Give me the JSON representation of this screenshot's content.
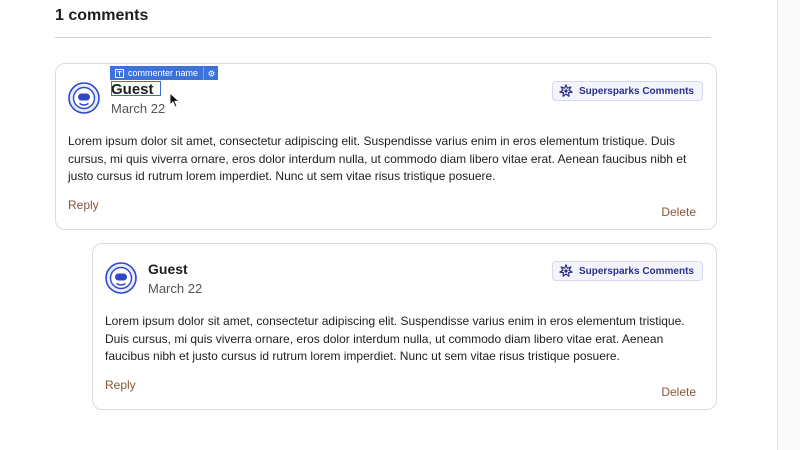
{
  "comments_section": {
    "count_heading": "1 comments"
  },
  "block_toolbar": {
    "label": "commenter name"
  },
  "comments": [
    {
      "author": "Guest",
      "date": "March 22",
      "badge": "Supersparks Comments",
      "body": "Lorem ipsum dolor sit amet, consectetur adipiscing elit. Suspendisse varius enim in eros elementum tristique. Duis cursus, mi quis viverra ornare, eros dolor interdum nulla, ut commodo diam libero vitae erat. Aenean faucibus nibh et justo cursus id rutrum lorem imperdiet. Nunc ut sem vitae risus tristique posuere.",
      "reply_label": "Reply",
      "delete_label": "Delete"
    },
    {
      "author": "Guest",
      "date": "March 22",
      "badge": "Supersparks Comments",
      "body": "Lorem ipsum dolor sit amet, consectetur adipiscing elit. Suspendisse varius enim in eros elementum tristique. Duis cursus, mi quis viverra ornare, eros dolor interdum nulla, ut commodo diam libero vitae erat. Aenean faucibus nibh et justo cursus id rutrum lorem imperdiet. Nunc ut sem vitae risus tristique posuere.",
      "reply_label": "Reply",
      "delete_label": "Delete"
    }
  ],
  "icons": {
    "avatar": "avatar-icon",
    "badge": "spark-icon",
    "toolbar_label": "text-field-icon",
    "toolbar_settings": "gear-icon",
    "cursor": "pointer-cursor-icon"
  },
  "colors": {
    "accent_link": "#8a5637",
    "badge_text": "#2b2f8a",
    "selection_blue": "#3b73d9"
  }
}
